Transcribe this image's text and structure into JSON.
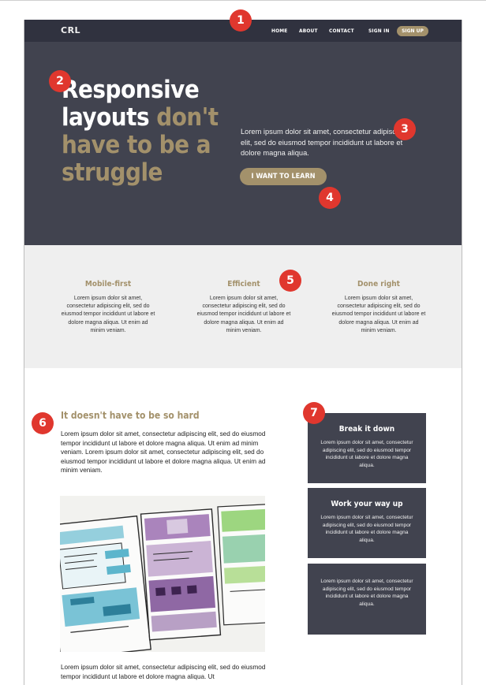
{
  "nav": {
    "logo": "CRL",
    "links": [
      "HOME",
      "ABOUT",
      "CONTACT",
      "SIGN IN"
    ],
    "signup": "SIGN UP"
  },
  "hero": {
    "title_white": "Responsive layouts",
    "title_gold": "don't have to be a struggle",
    "text": "Lorem ipsum dolor sit amet, consectetur adipiscing elit, sed do eiusmod tempor incididunt ut labore et dolore magna aliqua.",
    "button": "I WANT TO LEARN"
  },
  "features": [
    {
      "title": "Mobile-first",
      "text": "Lorem ipsum dolor sit amet, consectetur adipiscing elit, sed do eiusmod tempor incididunt ut labore et dolore magna aliqua. Ut enim ad minim veniam."
    },
    {
      "title": "Efficient",
      "text": "Lorem ipsum dolor sit amet, consectetur adipiscing elit, sed do eiusmod tempor incididunt ut labore et dolore magna aliqua. Ut enim ad minim veniam."
    },
    {
      "title": "Done right",
      "text": "Lorem ipsum dolor sit amet, consectetur adipiscing elit, sed do eiusmod tempor incididunt ut labore et dolore magna aliqua. Ut enim ad minim veniam."
    }
  ],
  "main": {
    "title": "It doesn't have to be so hard",
    "text": "Lorem ipsum dolor sit amet, consectetur adipiscing elit, sed do eiusmod tempor incididunt ut labore et dolore magna aliqua. Ut enim ad minim veniam. Lorem ipsum dolor sit amet, consectetur adipiscing elit, sed do eiusmod tempor incididunt ut labore et dolore magna aliqua. Ut enim ad minim veniam.",
    "text2": "Lorem ipsum dolor sit amet, consectetur adipiscing elit, sed do eiusmod tempor incididunt ut labore et dolore magna aliqua. Ut"
  },
  "cards": [
    {
      "title": "Break it down",
      "text": "Lorem ipsum dolor sit amet, consectetur adipiscing elit, sed do eiusmod tempor incididunt ut labore et dolore magna aliqua."
    },
    {
      "title": "Work your way up",
      "text": "Lorem ipsum dolor sit amet, consectetur adipiscing elit, sed do eiusmod tempor incididunt ut labore et dolore magna aliqua."
    },
    {
      "title": "",
      "text": "Lorem ipsum dolor sit amet, consectetur adipiscing elit, sed do eiusmod tempor incididunt ut labore et dolore magna aliqua."
    }
  ],
  "markers": [
    "1",
    "2",
    "3",
    "4",
    "5",
    "6",
    "7"
  ],
  "colors": {
    "dark": "#41434f",
    "nav": "#30323f",
    "accent": "#a3916b",
    "marker": "#e0372e",
    "light_bg": "#efefef"
  }
}
